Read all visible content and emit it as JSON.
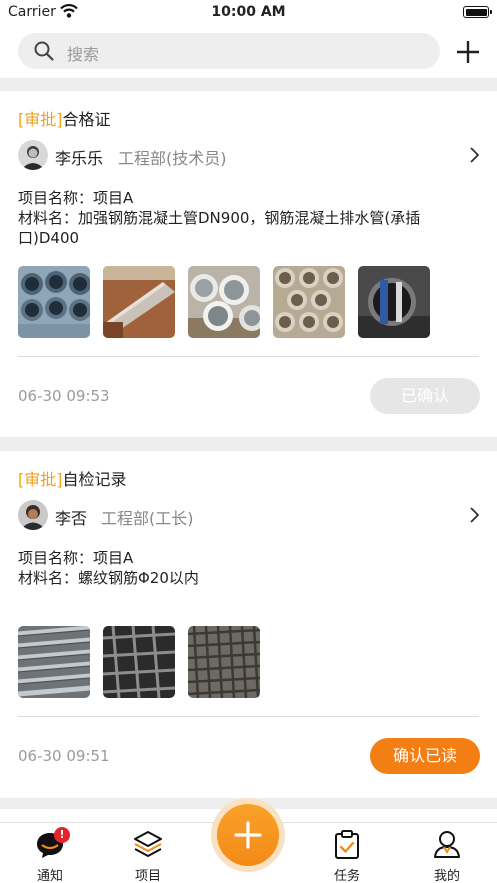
{
  "status_bar": {
    "carrier": "Carrier",
    "time": "10:00 AM"
  },
  "search": {
    "placeholder": "搜索"
  },
  "cards": [
    {
      "tag": "审批",
      "title": "合格证",
      "author": "李乐乐",
      "dept": "工程部(技术员)",
      "project_line": "项目名称：项目A",
      "material_line1": "材料名：加强钢筋混凝土管DN900，钢筋混凝土排水管(承插",
      "material_line2": "口)D400",
      "time": "06-30 09:53",
      "button": "已确认",
      "button_state": "confirmed"
    },
    {
      "tag": "审批",
      "title": "自检记录",
      "author": "李否",
      "dept": "工程部(工长)",
      "project_line": "项目名称：项目A",
      "material_line1": "材料名：螺纹钢筋Φ20以内",
      "time": "06-30 09:51",
      "button": "确认已读",
      "button_state": "pending"
    }
  ],
  "tabs": [
    {
      "label": "通知",
      "icon": "chat-bubble-icon",
      "badge": "!"
    },
    {
      "label": "项目",
      "icon": "layers-icon"
    },
    {
      "label": "任务",
      "icon": "clipboard-check-icon"
    },
    {
      "label": "我的",
      "icon": "user-icon"
    }
  ],
  "colors": {
    "accent": "#f27e14",
    "tag": "#f0a21a",
    "badge": "#e3242b"
  }
}
